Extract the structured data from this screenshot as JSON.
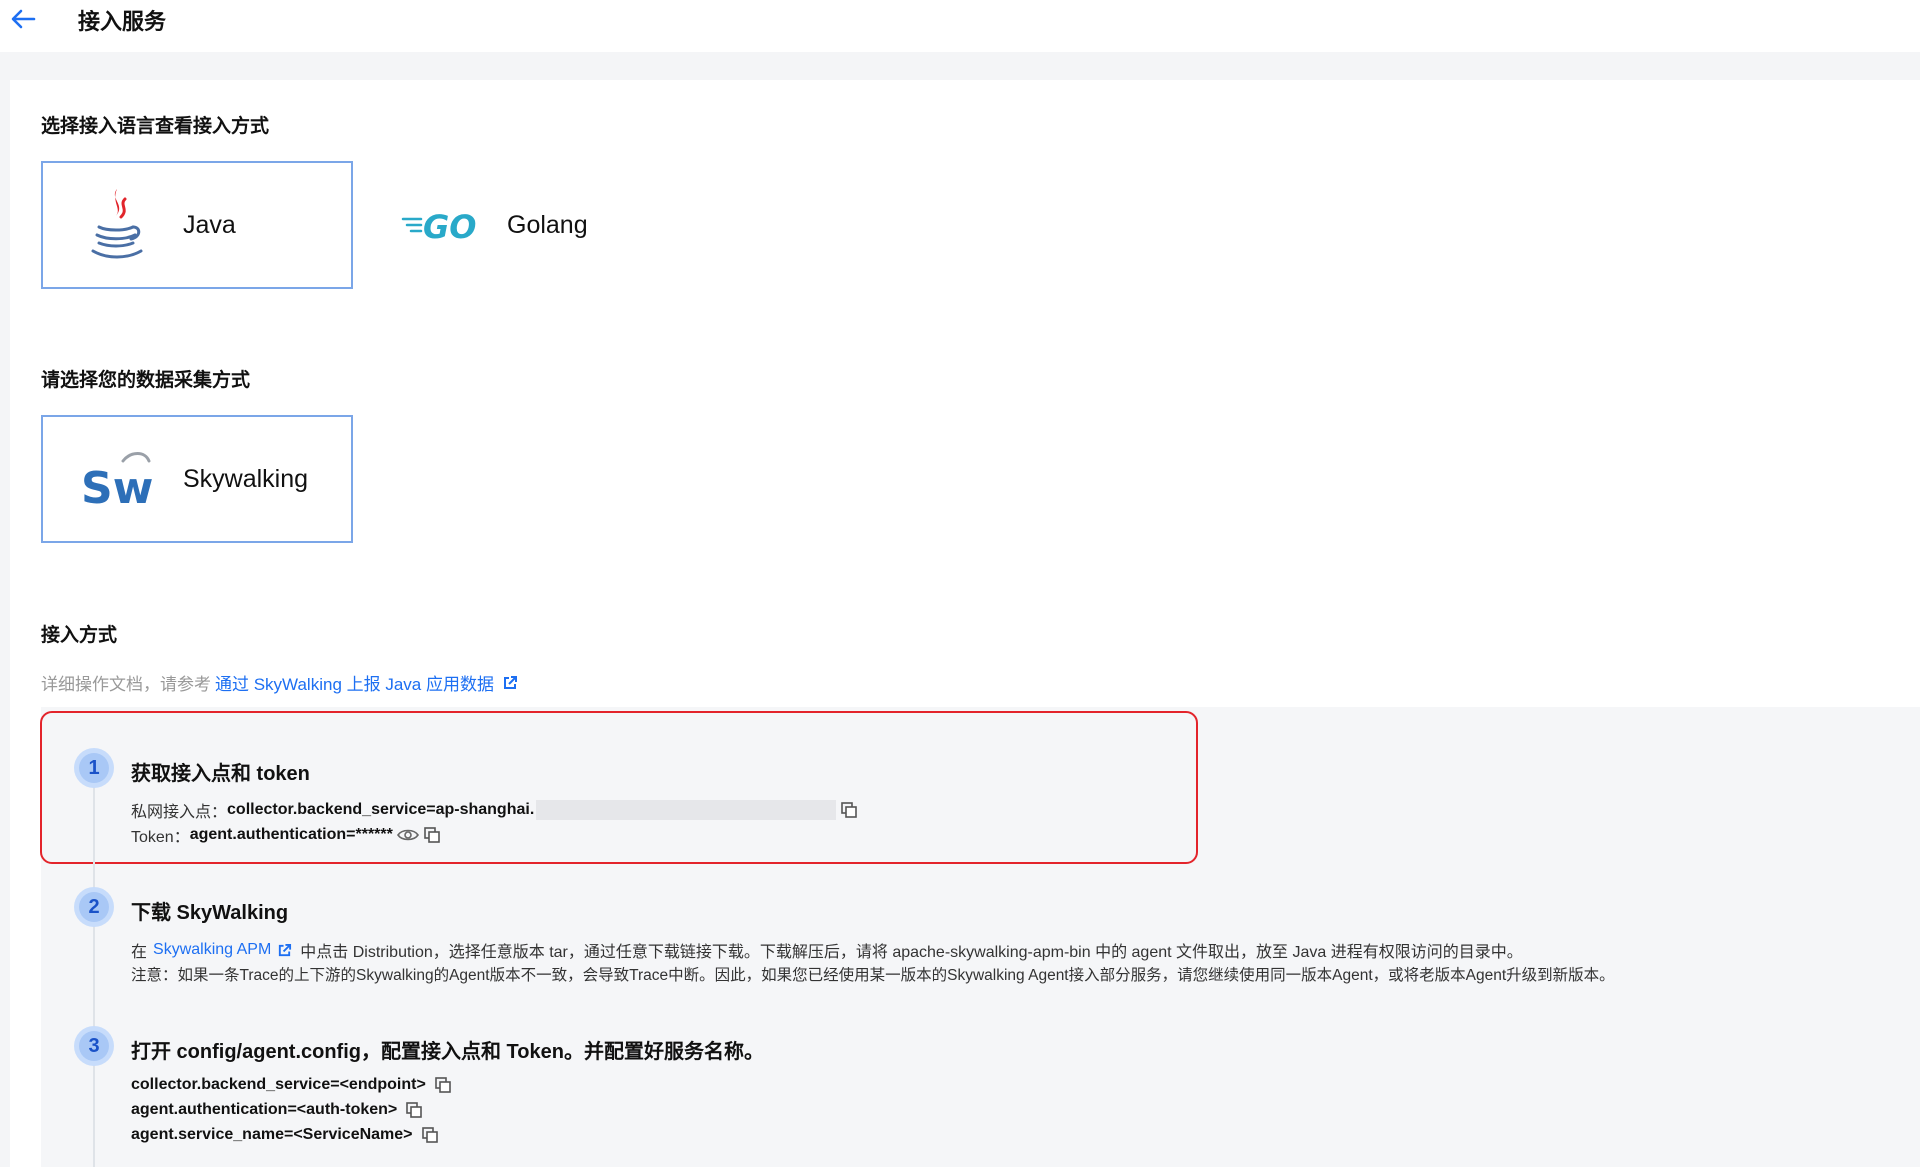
{
  "header": {
    "title": "接入服务"
  },
  "language_section": {
    "title": "选择接入语言查看接入方式",
    "options": [
      {
        "label": "Java",
        "icon": "java-icon",
        "selected": true
      },
      {
        "label": "Golang",
        "icon": "go-icon",
        "selected": false
      }
    ]
  },
  "collection_section": {
    "title": "请选择您的数据采集方式",
    "options": [
      {
        "label": "Skywalking",
        "icon": "skywalking-icon",
        "selected": true
      }
    ]
  },
  "access_section": {
    "title": "接入方式",
    "doc_prefix": "详细操作文档，请参考",
    "doc_link": "通过 SkyWalking 上报 Java 应用数据"
  },
  "steps": [
    {
      "number": "1",
      "title": "获取接入点和 token",
      "endpoint_label": "私网接入点：",
      "endpoint_value": "collector.backend_service=ap-shanghai.",
      "token_label": "Token：",
      "token_value": "agent.authentication=******"
    },
    {
      "number": "2",
      "title": "下载 SkyWalking",
      "line1_prefix": "在",
      "line1_link": "Skywalking APM",
      "line1_suffix": "中点击 Distribution，选择任意版本 tar，通过任意下载链接下载。下载解压后，请将 apache-skywalking-apm-bin 中的 agent 文件取出，放至 Java 进程有权限访问的目录中。",
      "line2": "注意：如果一条Trace的上下游的Skywalking的Agent版本不一致，会导致Trace中断。因此，如果您已经使用某一版本的Skywalking Agent接入部分服务，请您继续使用同一版本Agent，或将老版本Agent升级到新版本。"
    },
    {
      "number": "3",
      "title": "打开 config/agent.config，配置接入点和 Token。并配置好服务名称。",
      "config_lines": [
        "collector.backend_service=<endpoint>",
        "agent.authentication=<auth-token>",
        "agent.service_name=<ServiceName>"
      ]
    }
  ],
  "colors": {
    "accent": "#1d6ff2",
    "highlight_border": "#e3242b",
    "selected_border": "#7ba6e8",
    "skywalking_blue": "#2d6fb8",
    "go_cyan": "#29a9c9"
  }
}
